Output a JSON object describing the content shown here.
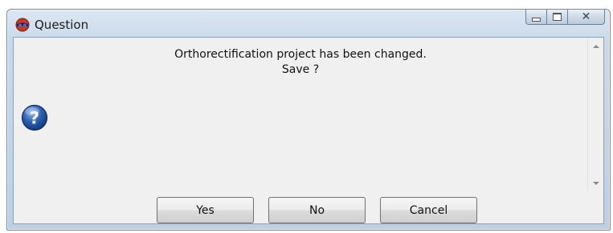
{
  "window": {
    "title": "Question"
  },
  "message": {
    "line1": "Orthorectification project has been changed.",
    "line2": "Save ?"
  },
  "icons": {
    "app": "app-icon",
    "message": "question-icon"
  },
  "buttons": {
    "yes": "Yes",
    "no": "No",
    "cancel": "Cancel"
  },
  "colors": {
    "title_gradient_top": "#dce7f3",
    "question_icon_blue": "#2a5fb0",
    "client_background": "#f0f0f0"
  }
}
